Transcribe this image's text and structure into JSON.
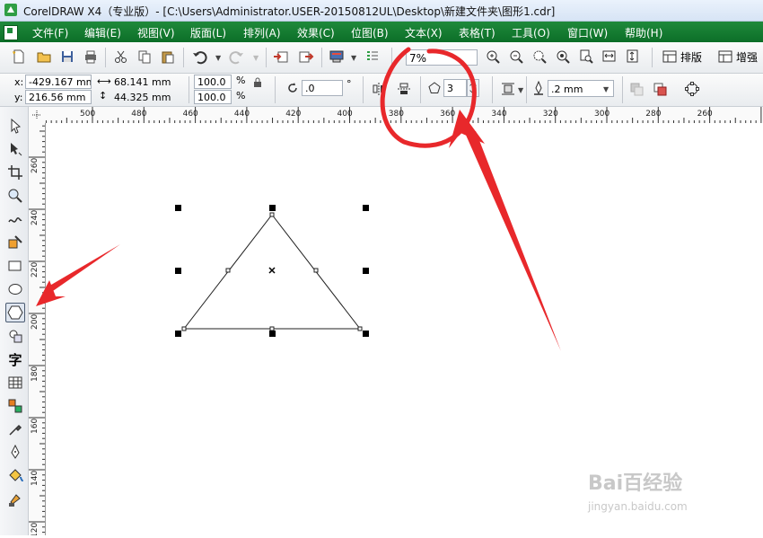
{
  "window": {
    "title": "CorelDRAW X4（专业版）- [C:\\Users\\Administrator.USER-20150812UL\\Desktop\\新建文件夹\\图形1.cdr]"
  },
  "menu": [
    {
      "label": "文件(F)"
    },
    {
      "label": "编辑(E)"
    },
    {
      "label": "视图(V)"
    },
    {
      "label": "版面(L)"
    },
    {
      "label": "排列(A)"
    },
    {
      "label": "效果(C)"
    },
    {
      "label": "位图(B)"
    },
    {
      "label": "文本(X)"
    },
    {
      "label": "表格(T)"
    },
    {
      "label": "工具(O)"
    },
    {
      "label": "窗口(W)"
    },
    {
      "label": "帮助(H)"
    }
  ],
  "standard_toolbar": {
    "zoom_value": "7%",
    "layout_button": "排版",
    "enhance_button": "增强"
  },
  "property_bar": {
    "x_label": "x:",
    "x_value": "-429.167 mm",
    "y_label": "y:",
    "y_value": "216.56 mm",
    "width_value": "68.141 mm",
    "height_value": "44.325 mm",
    "scale_x": "100.0",
    "scale_y": "100.0",
    "percent_symbol": "%",
    "rotation_value": ".0",
    "degree_symbol": "°",
    "sides_value": "3",
    "outline_width": ".2 mm"
  },
  "rulers": {
    "horizontal_ticks": [
      "500",
      "480",
      "460",
      "440",
      "420",
      "400",
      "380",
      "360",
      "340",
      "320",
      "300",
      "280",
      "260"
    ],
    "vertical_ticks": [
      "260",
      "240",
      "220",
      "200",
      "180",
      "160",
      "140",
      "120"
    ]
  },
  "toolbox": {
    "tools": [
      {
        "name": "pick-tool-icon"
      },
      {
        "name": "shape-tool-icon"
      },
      {
        "name": "crop-tool-icon"
      },
      {
        "name": "zoom-tool-icon"
      },
      {
        "name": "freehand-tool-icon"
      },
      {
        "name": "smart-fill-tool-icon"
      },
      {
        "name": "rectangle-tool-icon"
      },
      {
        "name": "ellipse-tool-icon"
      },
      {
        "name": "polygon-tool-icon"
      },
      {
        "name": "basic-shapes-tool-icon"
      },
      {
        "name": "text-tool-icon"
      },
      {
        "name": "table-tool-icon"
      },
      {
        "name": "interactive-blend-tool-icon"
      },
      {
        "name": "eyedropper-tool-icon"
      },
      {
        "name": "outline-pen-tool-icon"
      },
      {
        "name": "fill-tool-icon"
      },
      {
        "name": "interactive-fill-tool-icon"
      }
    ],
    "text_tool_glyph": "字",
    "active_tool": "polygon-tool-icon"
  },
  "watermark": {
    "brand": "Bai百经验",
    "url": "jingyan.baidu.com"
  },
  "colors": {
    "menubar": "#0c6e28",
    "annotation": "#e8282b",
    "accent": "#1f8a3b"
  }
}
